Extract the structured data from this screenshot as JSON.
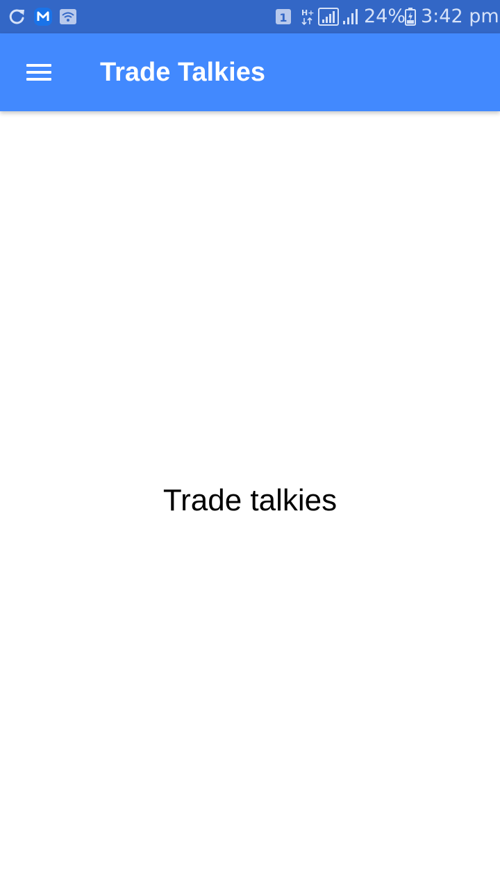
{
  "status_bar": {
    "icons_left": [
      "sync-icon",
      "messenger-app-icon",
      "wifi-notification-icon"
    ],
    "icons_right": [
      "sim1-icon",
      "hplus-data-icon",
      "signal-sim1-icon",
      "signal-sim2-icon",
      "battery-charging-icon"
    ],
    "battery_percent": "24%",
    "time": "3:42 pm",
    "background_color": "#3367c6"
  },
  "app_bar": {
    "title": "Trade Talkies",
    "menu_icon": "hamburger-menu-icon",
    "background_color": "#4289fe"
  },
  "main": {
    "text": "Trade talkies"
  }
}
